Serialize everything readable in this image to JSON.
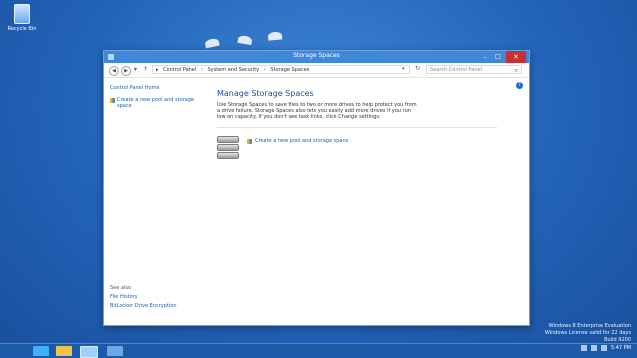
{
  "desktop": {
    "recycle_bin_label": "Recycle Bin",
    "watermark": [
      "Windows 8 Enterprise Evaluation",
      "Windows License valid for 22 days",
      "Build 9200"
    ]
  },
  "window": {
    "title": "Storage Spaces",
    "controls": {
      "minimize": "–",
      "maximize": "☐",
      "close": "✕"
    }
  },
  "address": {
    "breadcrumb": [
      "Control Panel",
      "System and Security",
      "Storage Spaces"
    ],
    "search_placeholder": "Search Control Panel"
  },
  "sidebar": {
    "home_link": "Control Panel Home",
    "task_link": "Create a new pool and storage space",
    "see_also_heading": "See also",
    "see_also_links": [
      "File History",
      "BitLocker Drive Encryption"
    ]
  },
  "main": {
    "heading": "Manage Storage Spaces",
    "description": "Use Storage Spaces to save files to two or more drives to help protect you from a drive failure. Storage Spaces also lets you easily add more drives if you run low on capacity. If you don't see task links, click Change settings.",
    "create_link": "Create a new pool and storage space"
  },
  "taskbar": {
    "time": "5:47 PM"
  },
  "icons": {
    "recycle_bin": "recycle-bin-icon",
    "help": "help-icon",
    "shield": "shield-icon",
    "search": "search-icon",
    "drive_stack": "storage-drives-icon"
  },
  "colors": {
    "accent": "#3f88d9",
    "link": "#1a5fb4",
    "close": "#c8302f",
    "desktop": "#2263b8"
  }
}
